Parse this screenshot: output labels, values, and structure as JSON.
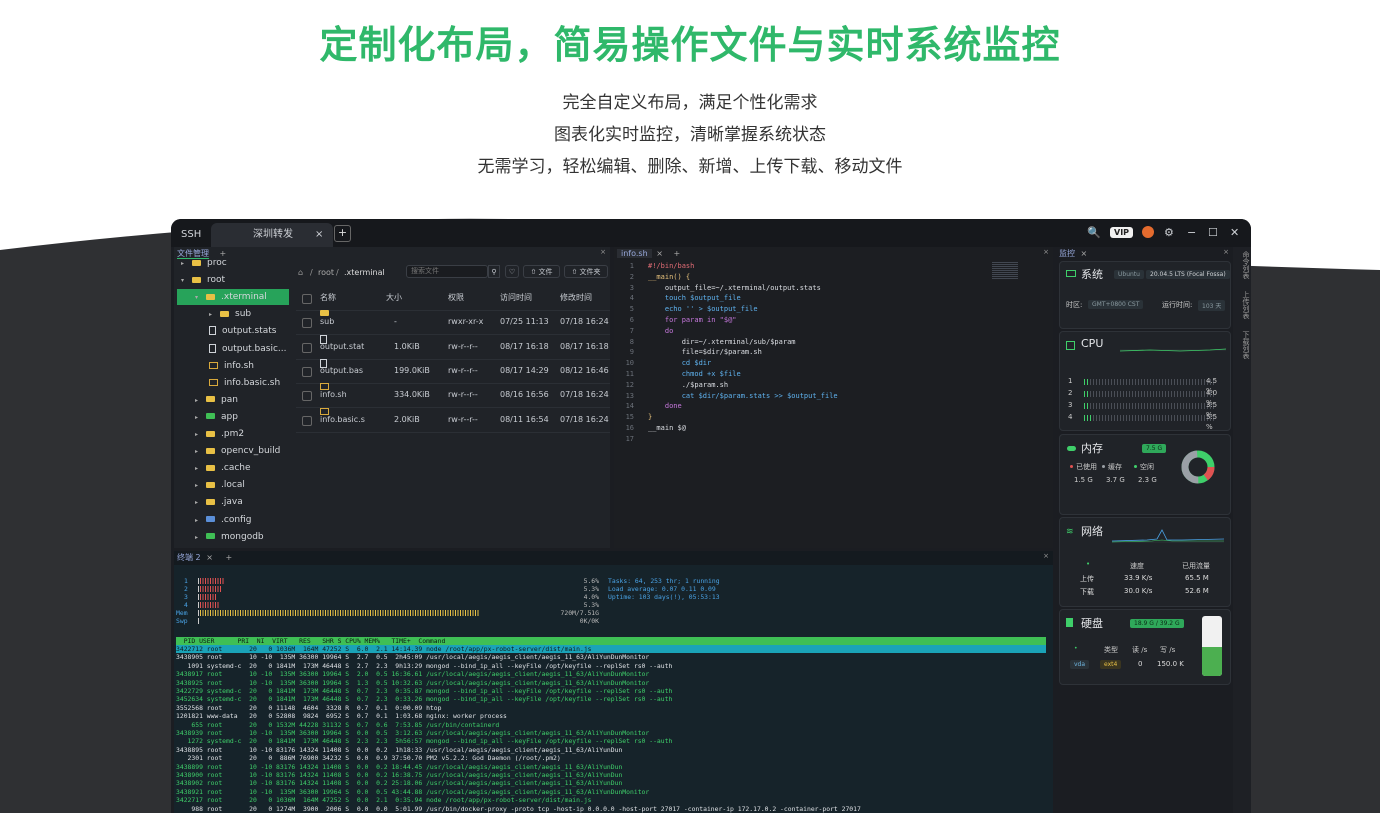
{
  "hero": {
    "title": "定制化布局，简易操作文件与实时系统监控",
    "lines": [
      "完全自定义布局，满足个性化需求",
      "图表化实时监控，清晰掌握系统状态",
      "无需学习，轻松编辑、删除、新增、上传下载、移动文件"
    ]
  },
  "titlebar": {
    "tabs": [
      {
        "label": "SSH"
      },
      {
        "label": "深圳转发"
      }
    ],
    "close_glyph": "×",
    "add_glyph": "+",
    "vip": "VIP",
    "controls": {
      "search": "🔍",
      "settings": "⚙",
      "minimize": "−",
      "maximize": "☐",
      "close": "✕"
    }
  },
  "file_manager": {
    "tab_label": "文件管理",
    "add": "+",
    "tree": [
      {
        "label": "proc",
        "type": "folder",
        "level": 1,
        "arrow": "▸"
      },
      {
        "label": "root",
        "type": "folder",
        "level": 1,
        "arrow": "▾"
      },
      {
        "label": ".xterminal",
        "type": "folder",
        "level": 2,
        "arrow": "▾",
        "selected": true
      },
      {
        "label": "sub",
        "type": "folder",
        "level": 3,
        "arrow": "▸"
      },
      {
        "label": "output.stats",
        "type": "file",
        "level": 3
      },
      {
        "label": "output.basic...",
        "type": "file",
        "level": 3
      },
      {
        "label": "info.sh",
        "type": "sh",
        "level": 3
      },
      {
        "label": "info.basic.sh",
        "type": "sh",
        "level": 3
      },
      {
        "label": "pan",
        "type": "folder",
        "level": 2,
        "arrow": "▸"
      },
      {
        "label": "app",
        "type": "app",
        "level": 2,
        "arrow": "▸"
      },
      {
        "label": ".pm2",
        "type": "folder",
        "level": 2,
        "arrow": "▸"
      },
      {
        "label": "opencv_build",
        "type": "folder",
        "level": 2,
        "arrow": "▸"
      },
      {
        "label": ".cache",
        "type": "folder",
        "level": 2,
        "arrow": "▸"
      },
      {
        "label": ".local",
        "type": "folder",
        "level": 2,
        "arrow": "▸"
      },
      {
        "label": ".java",
        "type": "folder",
        "level": 2,
        "arrow": "▸"
      },
      {
        "label": ".config",
        "type": "config",
        "level": 2,
        "arrow": "▸"
      },
      {
        "label": "mongodb",
        "type": "app",
        "level": 2,
        "arrow": "▸"
      }
    ],
    "breadcrumb": [
      "root",
      ".xterminal"
    ],
    "breadcrumb_sep": "/",
    "search_placeholder": "搜索文件",
    "btn_file": "文件",
    "btn_folder": "文件夹",
    "columns": [
      "名称",
      "大小",
      "权限",
      "访问时间",
      "修改时间"
    ],
    "rows": [
      {
        "name": "sub",
        "type": "folder",
        "size": "-",
        "perm": "rwxr-xr-x",
        "atime": "07/25 11:13",
        "mtime": "07/18 16:24"
      },
      {
        "name": "output.stat",
        "type": "file",
        "size": "1.0KiB",
        "perm": "rw-r--r--",
        "atime": "08/17 16:18",
        "mtime": "08/17 16:18"
      },
      {
        "name": "output.bas",
        "type": "file",
        "size": "199.0KiB",
        "perm": "rw-r--r--",
        "atime": "08/17 14:29",
        "mtime": "08/12 16:46"
      },
      {
        "name": "info.sh",
        "type": "sh",
        "size": "334.0KiB",
        "perm": "rw-r--r--",
        "atime": "08/16 16:56",
        "mtime": "07/18 16:24"
      },
      {
        "name": "info.basic.s",
        "type": "sh",
        "size": "2.0KiB",
        "perm": "rw-r--r--",
        "atime": "08/11 16:54",
        "mtime": "07/18 16:24"
      }
    ]
  },
  "editor": {
    "tab_label": "info.sh",
    "lines": [
      {
        "n": "1",
        "text": "#!/bin/bash",
        "color": "#e06c75"
      },
      {
        "n": "2",
        "text": "__main() {",
        "color": "#e5c07b"
      },
      {
        "n": "3",
        "text": "    output_file=~/.xterminal/output.stats",
        "color": "#dcdfe4"
      },
      {
        "n": "4",
        "text": "    touch $output_file",
        "color": "#5fb3f0"
      },
      {
        "n": "5",
        "text": "    echo '' > $output_file",
        "color": "#5fb3f0"
      },
      {
        "n": "6",
        "text": "    for param in \"$@\"",
        "color": "#c678dd"
      },
      {
        "n": "7",
        "text": "    do",
        "color": "#c678dd"
      },
      {
        "n": "8",
        "text": "        dir=~/.xterminal/sub/$param",
        "color": "#dcdfe4"
      },
      {
        "n": "9",
        "text": "        file=$dir/$param.sh",
        "color": "#dcdfe4"
      },
      {
        "n": "10",
        "text": "        cd $dir",
        "color": "#5fb3f0"
      },
      {
        "n": "11",
        "text": "        chmod +x $file",
        "color": "#5fb3f0"
      },
      {
        "n": "12",
        "text": "        ./$param.sh",
        "color": "#dcdfe4"
      },
      {
        "n": "13",
        "text": "        cat $dir/$param.stats >> $output_file",
        "color": "#5fb3f0"
      },
      {
        "n": "14",
        "text": "    done",
        "color": "#c678dd"
      },
      {
        "n": "15",
        "text": "}",
        "color": "#e5c07b"
      },
      {
        "n": "16",
        "text": "__main $@",
        "color": "#dcdfe4"
      },
      {
        "n": "17",
        "text": "",
        "color": "#dcdfe4"
      }
    ]
  },
  "monitor": {
    "tab_label": "监控",
    "side_tabs": [
      "命令列表",
      "上传列表",
      "下载列表"
    ],
    "system": {
      "title": "系统",
      "os": "Ubuntu",
      "version": "20.04.5 LTS (Focal Fossa)",
      "tz_label": "时区:",
      "tz": "GMT+0800 CST",
      "uptime_label": "运行时间:",
      "uptime": "103 天"
    },
    "cpu": {
      "title": "CPU",
      "cores": [
        {
          "id": "1",
          "pct": "4.5 %",
          "value": 0.045
        },
        {
          "id": "2",
          "pct": "4.0 %",
          "value": 0.04
        },
        {
          "id": "3",
          "pct": "3.5 %",
          "value": 0.035
        },
        {
          "id": "4",
          "pct": "5.5 %",
          "value": 0.055
        }
      ]
    },
    "memory": {
      "title": "内存",
      "total": "7.5 G",
      "legend": [
        {
          "label": "已使用",
          "value": "1.5 G",
          "color": "#e05252"
        },
        {
          "label": "缓存",
          "value": "3.7 G",
          "color": "#9aa0a6"
        },
        {
          "label": "空闲",
          "value": "2.3 G",
          "color": "#3fcf6a"
        }
      ]
    },
    "network": {
      "title": "网络",
      "headers": [
        "速度",
        "已用流量"
      ],
      "dot": "•",
      "rows": [
        {
          "label": "上传",
          "speed": "33.9 K/s",
          "total": "65.5 M"
        },
        {
          "label": "下载",
          "speed": "30.0 K/s",
          "total": "52.6 M"
        }
      ]
    },
    "disk": {
      "title": "硬盘",
      "usage": "18.9 G / 39.2 G",
      "fill": 0.48,
      "headers": [
        "类型",
        "读 /s",
        "写 /s"
      ],
      "dev": "vda",
      "type": "ext4",
      "read": "0",
      "write": "150.0 K"
    }
  },
  "terminal": {
    "tab_label": "终端 2",
    "add": "+",
    "meters": [
      {
        "label": "1",
        "pct": "5.6%"
      },
      {
        "label": "2",
        "pct": "5.3%"
      },
      {
        "label": "3",
        "pct": "4.0%"
      },
      {
        "label": "4",
        "pct": "5.3%"
      },
      {
        "label": "Mem",
        "pct": "720M/7.51G"
      },
      {
        "label": "Swp",
        "pct": "0K/0K"
      }
    ],
    "tasks": "Tasks: 64, 253 thr; 1 running",
    "load": "Load average: 0.07 0.11 0.09",
    "uptime": "Uptime: 103 days(!), 05:53:13",
    "header": "  PID USER      PRI  NI  VIRT   RES   SHR S CPU% MEM%   TIME+  Command",
    "procs": [
      {
        "text": "3422712 root       20   0 1036M  164M 47252 S  6.0  2.1 14:14.39 node /root/app/px-robot-server/dist/main.js",
        "color": "#0f1a1e",
        "hl": true
      },
      {
        "text": "3438905 root       10 -10  135M 36300 19964 S  2.7  0.5  2h45:09 /usr/local/aegis/aegis_client/aegis_11_63/AliYunDunMonitor",
        "color": "#dfe2e6"
      },
      {
        "text": "   1091 systemd-c  20   0 1841M  173M 46448 S  2.7  2.3  9h13:29 mongod --bind_ip_all --keyFile /opt/keyfile --replSet rs0 --auth",
        "color": "#dfe2e6"
      },
      {
        "text": "3438917 root       10 -10  135M 36300 19964 S  2.0  0.5 16:36.61 /usr/local/aegis/aegis_client/aegis_11_63/AliYunDunMonitor",
        "color": "#3fcf6a"
      },
      {
        "text": "3438925 root       10 -10  135M 36300 19964 S  1.3  0.5 10:32.63 /usr/local/aegis/aegis_client/aegis_11_63/AliYunDunMonitor",
        "color": "#3fcf6a"
      },
      {
        "text": "3422729 systemd-c  20   0 1841M  173M 46448 S  0.7  2.3  0:35.87 mongod --bind_ip_all --keyFile /opt/keyfile --replSet rs0 --auth",
        "color": "#3fcf6a"
      },
      {
        "text": "3452634 systemd-c  20   0 1841M  173M 46448 S  0.7  2.3  0:33.26 mongod --bind_ip_all --keyFile /opt/keyfile --replSet rs0 --auth",
        "color": "#3fcf6a"
      },
      {
        "text": "3552568 root       20   0 11148  4604  3328 R  0.7  0.1  0:00.09 htop",
        "color": "#dfe2e6"
      },
      {
        "text": "1201821 www-data   20   0 52808  9824  6952 S  0.7  0.1  1:03.68 nginx: worker process",
        "color": "#dfe2e6"
      },
      {
        "text": "    655 root       20   0 1532M 44228 31132 S  0.7  0.6  7:53.85 /usr/bin/containerd",
        "color": "#3fcf6a"
      },
      {
        "text": "3438939 root       10 -10  135M 36300 19964 S  0.0  0.5  3:12.63 /usr/local/aegis/aegis_client/aegis_11_63/AliYunDunMonitor",
        "color": "#3fcf6a"
      },
      {
        "text": "   1272 systemd-c  20   0 1841M  173M 46448 S  2.3  2.3  5h56:57 mongod --bind_ip_all --keyFile /opt/keyfile --replSet rs0 --auth",
        "color": "#3fcf6a"
      },
      {
        "text": "3438895 root       10 -10 83176 14324 11408 S  0.0  0.2  1h18:33 /usr/local/aegis/aegis_client/aegis_11_63/AliYunDun",
        "color": "#dfe2e6"
      },
      {
        "text": "   2301 root       20   0  886M 76900 34232 S  0.0  0.9 37:50.70 PM2 v5.2.2: God Daemon (/root/.pm2)",
        "color": "#dfe2e6"
      },
      {
        "text": "3438899 root       10 -10 83176 14324 11408 S  0.0  0.2 18:44.45 /usr/local/aegis/aegis_client/aegis_11_63/AliYunDun",
        "color": "#3fcf6a"
      },
      {
        "text": "3438900 root       10 -10 83176 14324 11408 S  0.0  0.2 16:38.75 /usr/local/aegis/aegis_client/aegis_11_63/AliYunDun",
        "color": "#3fcf6a"
      },
      {
        "text": "3438902 root       10 -10 83176 14324 11408 S  0.0  0.2 25:18.06 /usr/local/aegis/aegis_client/aegis_11_63/AliYunDun",
        "color": "#3fcf6a"
      },
      {
        "text": "3438921 root       10 -10  135M 36300 19964 S  0.0  0.5 43:44.88 /usr/local/aegis/aegis_client/aegis_11_63/AliYunDunMonitor",
        "color": "#3fcf6a"
      },
      {
        "text": "3422717 root       20   0 1036M  164M 47252 S  0.0  2.1  0:35.94 node /root/app/px-robot-server/dist/main.js",
        "color": "#3fcf6a"
      },
      {
        "text": "    988 root       20   0 1274M  3900  2006 S  0.0  0.0  5:01.99 /usr/bin/docker-proxy -proto tcp -host-ip 0.0.0.0 -host-port 27017 -container-ip 172.17.0.2 -container-port 27017",
        "color": "#dfe2e6"
      }
    ]
  }
}
